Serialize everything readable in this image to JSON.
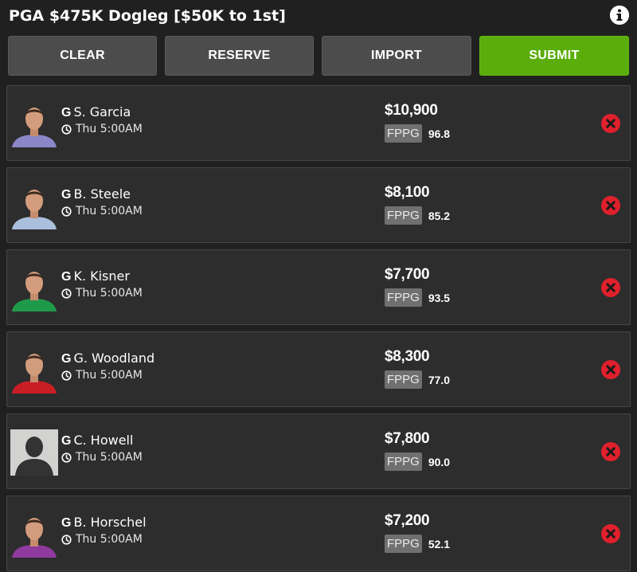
{
  "header": {
    "title": "PGA $475K Dogleg [$50K to 1st]",
    "info_icon": "info-icon"
  },
  "toolbar": {
    "clear_label": "CLEAR",
    "reserve_label": "RESERVE",
    "import_label": "IMPORT",
    "submit_label": "SUBMIT",
    "submit_color": "#5aad0b",
    "button_color": "#4c4c4c"
  },
  "lineup": {
    "fppg_label": "FPPG",
    "remove_icon": "remove-icon",
    "clock_icon": "clock-icon",
    "remove_color": "#e0202c",
    "players": [
      {
        "pos": "G",
        "name": "S. Garcia",
        "time": "Thu 5:00AM",
        "salary": "$10,900",
        "fppg": "96.8",
        "shirt_color": "#8a86c8"
      },
      {
        "pos": "G",
        "name": "B. Steele",
        "time": "Thu 5:00AM",
        "salary": "$8,100",
        "fppg": "85.2",
        "shirt_color": "#a9bfdc"
      },
      {
        "pos": "G",
        "name": "K. Kisner",
        "time": "Thu 5:00AM",
        "salary": "$7,700",
        "fppg": "93.5",
        "shirt_color": "#1f9a4a"
      },
      {
        "pos": "G",
        "name": "G. Woodland",
        "time": "Thu 5:00AM",
        "salary": "$8,300",
        "fppg": "77.0",
        "shirt_color": "#c81e24"
      },
      {
        "pos": "G",
        "name": "C. Howell",
        "time": "Thu 5:00AM",
        "salary": "$7,800",
        "fppg": "90.0",
        "shirt_color": "placeholder"
      },
      {
        "pos": "G",
        "name": "B. Horschel",
        "time": "Thu 5:00AM",
        "salary": "$7,200",
        "fppg": "52.1",
        "shirt_color": "#8e3a9e"
      }
    ]
  }
}
